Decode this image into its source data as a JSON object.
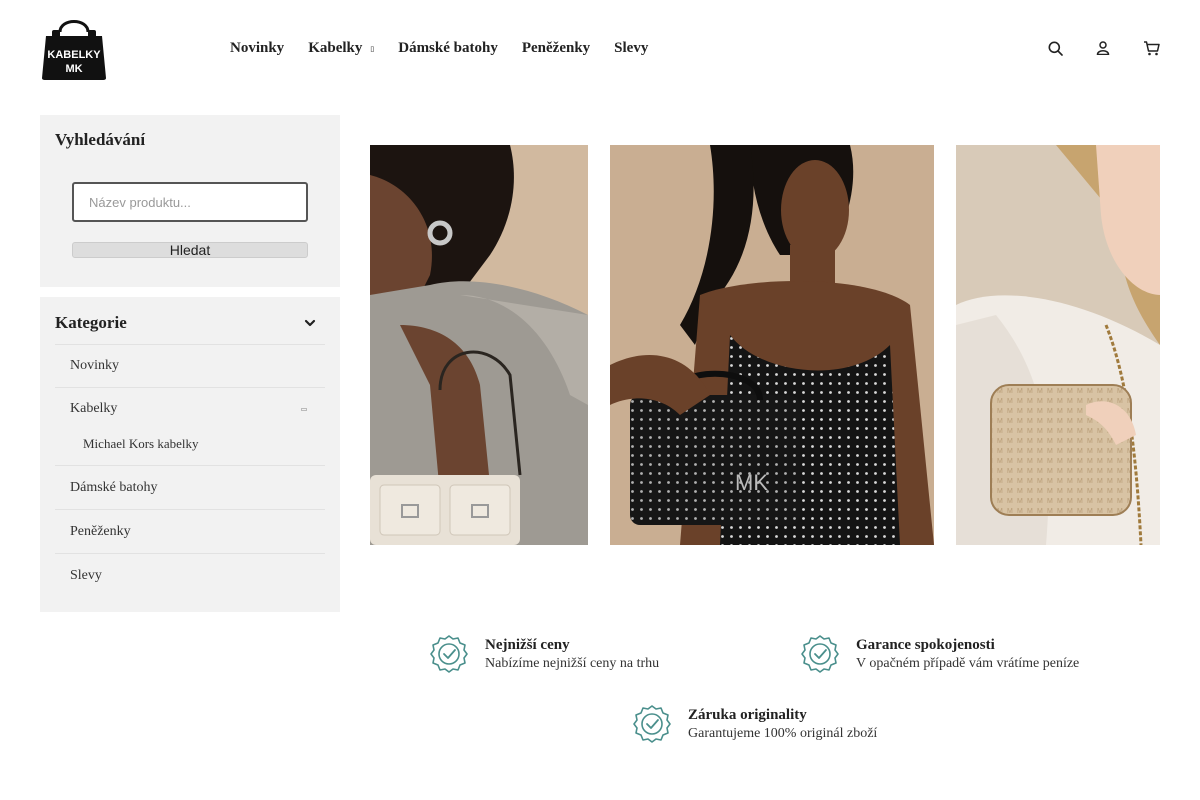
{
  "header": {
    "logo_text_line1": "KABELKY",
    "logo_text_line2": "MK",
    "nav": [
      {
        "label": "Novinky"
      },
      {
        "label": "Kabelky",
        "has_dropdown": true
      },
      {
        "label": "Dámské batohy"
      },
      {
        "label": "Peněženky"
      },
      {
        "label": "Slevy"
      }
    ],
    "icons": [
      "search-icon",
      "user-icon",
      "cart-icon"
    ]
  },
  "search": {
    "title": "Vyhledávání",
    "placeholder": "Název produktu...",
    "button_label": "Hledat"
  },
  "categories": {
    "title": "Kategorie",
    "items": [
      {
        "label": "Novinky"
      },
      {
        "label": "Kabelky",
        "subitems": [
          {
            "label": "Michael Kors kabelky"
          }
        ]
      },
      {
        "label": "Dámské batohy"
      },
      {
        "label": "Peněženky"
      },
      {
        "label": "Slevy"
      }
    ]
  },
  "slides": [
    {
      "alt": "model-white-shoulder-bag"
    },
    {
      "alt": "model-black-studded-handbag"
    },
    {
      "alt": "model-monogram-crossbody-bag"
    }
  ],
  "features": [
    {
      "title": "Nejnižší ceny",
      "subtitle": "Nabízíme nejnižší ceny na trhu",
      "icon": "check-badge-icon"
    },
    {
      "title": "Garance spokojenosti",
      "subtitle": "V opačném případě vám vrátíme peníze",
      "icon": "check-badge-icon"
    },
    {
      "title": "Záruka originality",
      "subtitle": "Garantujeme 100% originál zboží",
      "icon": "check-badge-icon"
    }
  ],
  "colors": {
    "sidebar_bg": "#f2f2f2",
    "badge_teal": "#4a8f8c",
    "text": "#222222"
  }
}
